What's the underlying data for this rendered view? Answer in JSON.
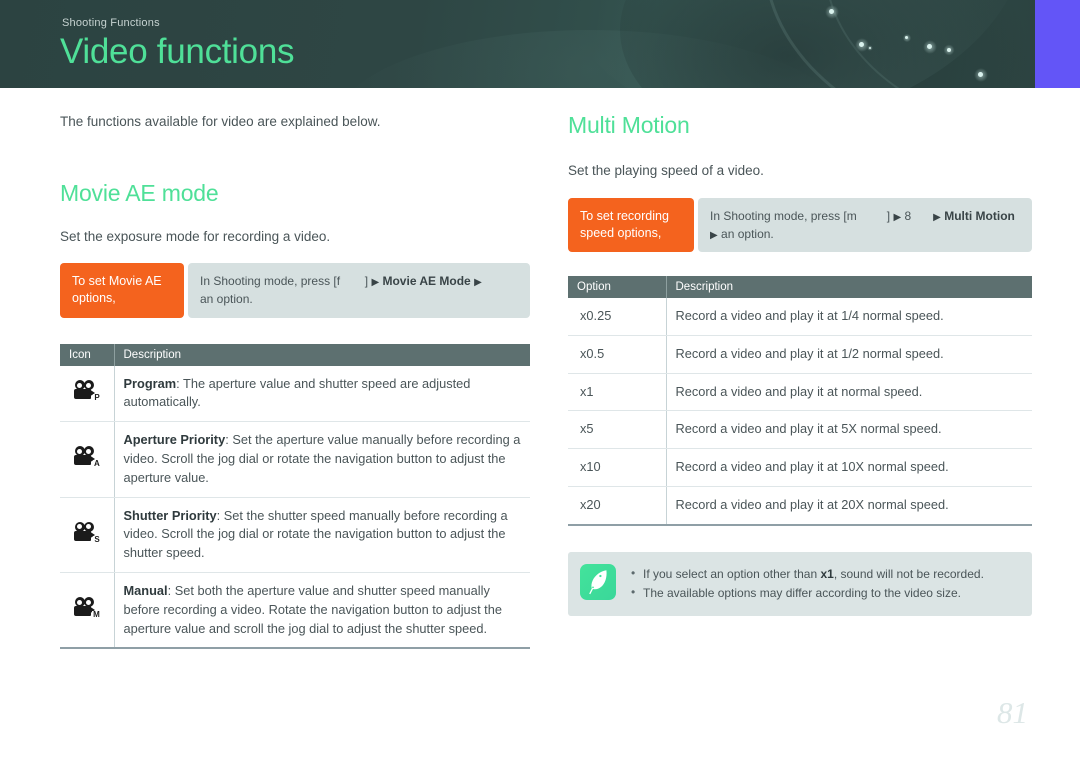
{
  "banner": {
    "eyebrow": "Shooting Functions",
    "title": "Video functions",
    "accent_green": "#4fe098",
    "background_teal": "#2f4644",
    "purple_block": "#6355f7"
  },
  "left_column": {
    "lede": "The functions available for video are explained below.",
    "heading": "Movie AE mode",
    "subtitle": "Set the exposure mode for recording a video.",
    "nav": {
      "tag_label": "To set Movie AE options,",
      "path_prefix": "In Shooting mode, press [",
      "path_button_glyph": "f",
      "path_button_close": "]",
      "arrow": "▶",
      "path_item_1": "Movie AE Mode",
      "path_suffix": "an option."
    },
    "table": {
      "headers": [
        "Icon",
        "Description"
      ],
      "rows": [
        {
          "icon_letter": "P",
          "icon_name": "camcorder-program-icon",
          "term": "Program",
          "description": ": The aperture value and shutter speed are adjusted automatically."
        },
        {
          "icon_letter": "A",
          "icon_name": "camcorder-aperture-priority-icon",
          "term": "Aperture Priority",
          "description": ": Set the aperture value manually before recording a video. Scroll the jog dial or rotate the navigation button to adjust the aperture value."
        },
        {
          "icon_letter": "S",
          "icon_name": "camcorder-shutter-priority-icon",
          "term": "Shutter Priority",
          "description": ": Set the shutter speed manually before recording a video. Scroll the jog dial or rotate the navigation button to adjust the shutter speed."
        },
        {
          "icon_letter": "M",
          "icon_name": "camcorder-manual-icon",
          "term": "Manual",
          "description": ": Set both the aperture value and shutter speed manually before recording a video. Rotate the navigation button to adjust the aperture value and scroll the jog dial to adjust the shutter speed."
        }
      ]
    }
  },
  "right_column": {
    "heading": "Multi Motion",
    "subtitle": "Set the playing speed of a video.",
    "nav": {
      "tag_label": "To set recording speed options,",
      "path_prefix": "In Shooting mode, press [",
      "path_button_glyph": "m",
      "path_button_close": "]",
      "arrow": "▶",
      "path_item_1": "8",
      "path_item_2": "Multi Motion",
      "path_suffix": "an option."
    },
    "table": {
      "headers": [
        "Option",
        "Description"
      ],
      "rows": [
        {
          "option": "x0.25",
          "description": "Record a video and play it at 1/4 normal speed."
        },
        {
          "option": "x0.5",
          "description": "Record a video and play it at 1/2 normal speed."
        },
        {
          "option": "x1",
          "description": "Record a video and play it at normal speed."
        },
        {
          "option": "x5",
          "description": "Record a video and play it at 5X normal speed."
        },
        {
          "option": "x10",
          "description": "Record a video and play it at 10X normal speed."
        },
        {
          "option": "x20",
          "description": "Record a video and play it at 20X normal speed."
        }
      ]
    },
    "note": {
      "icon_name": "quill-pen-note-icon",
      "items": [
        {
          "pre": "If you select an option other than ",
          "strong": "x1",
          "post": ", sound will not be recorded."
        },
        {
          "pre": "The available options may differ according to the video size.",
          "strong": "",
          "post": ""
        }
      ]
    }
  },
  "footer": {
    "page_number": "81"
  }
}
